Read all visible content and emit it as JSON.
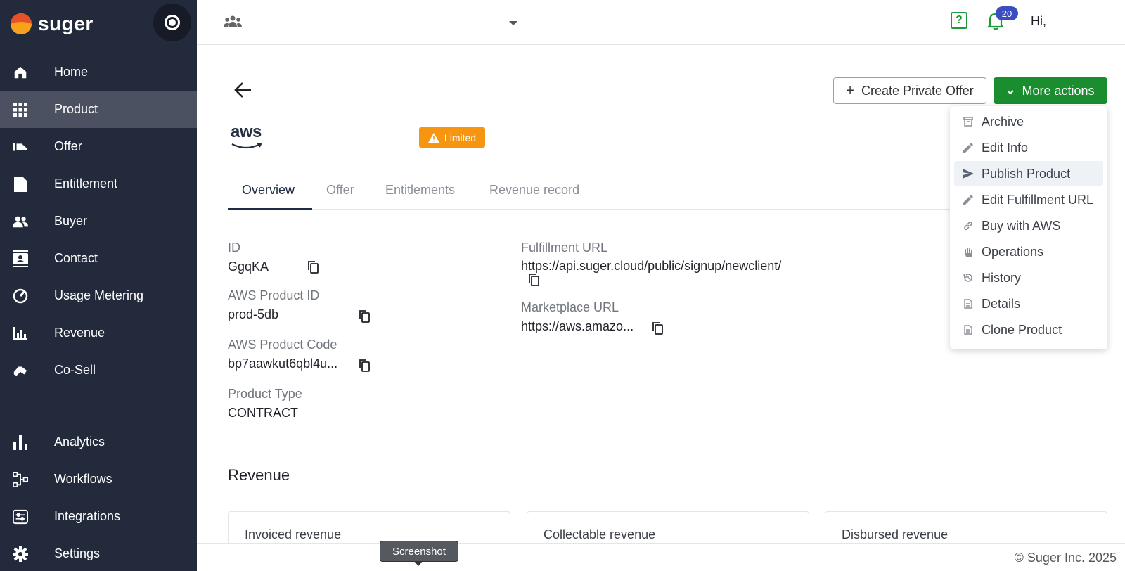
{
  "brand": {
    "name": "suger"
  },
  "sidebar": {
    "items": [
      {
        "label": "Home",
        "icon": "home-icon"
      },
      {
        "label": "Product",
        "icon": "grid-icon",
        "active": true
      },
      {
        "label": "Offer",
        "icon": "offer-icon"
      },
      {
        "label": "Entitlement",
        "icon": "document-icon"
      },
      {
        "label": "Buyer",
        "icon": "people-icon"
      },
      {
        "label": "Contact",
        "icon": "contact-card-icon"
      },
      {
        "label": "Usage Metering",
        "icon": "gauge-icon"
      },
      {
        "label": "Revenue",
        "icon": "revenue-chart-icon"
      },
      {
        "label": "Co-Sell",
        "icon": "handshake-icon"
      },
      {
        "label": "Analytics",
        "icon": "bar-chart-icon"
      },
      {
        "label": "Workflows",
        "icon": "workflow-icon"
      },
      {
        "label": "Integrations",
        "icon": "integrations-icon"
      },
      {
        "label": "Settings",
        "icon": "gear-icon"
      }
    ]
  },
  "header": {
    "notification_count": "20",
    "greeting": "Hi,"
  },
  "actions": {
    "create_private_offer": "Create Private Offer",
    "more_actions": "More actions"
  },
  "product": {
    "marketplace": "aws",
    "status": "Limited"
  },
  "tabs": [
    "Overview",
    "Offer",
    "Entitlements",
    "Revenue record"
  ],
  "fields": {
    "id_label": "ID",
    "id_value": "GgqKA",
    "aws_product_id_label": "AWS Product ID",
    "aws_product_id_value": "prod-5db",
    "aws_product_code_label": "AWS Product Code",
    "aws_product_code_value": "bp7aawkut6qbl4u...",
    "product_type_label": "Product Type",
    "product_type_value": "CONTRACT",
    "fulfillment_url_label": "Fulfillment URL",
    "fulfillment_url_value": "https://api.suger.cloud/public/signup/newclient/",
    "marketplace_url_label": "Marketplace URL",
    "marketplace_url_value": "https://aws.amazo..."
  },
  "revenue": {
    "title": "Revenue",
    "cards": [
      "Invoiced revenue",
      "Collectable revenue",
      "Disbursed revenue"
    ]
  },
  "menu": {
    "items": [
      {
        "label": "Archive",
        "icon": "archive-icon"
      },
      {
        "label": "Edit Info",
        "icon": "pencil-icon"
      },
      {
        "label": "Publish Product",
        "icon": "send-icon",
        "highlighted": true
      },
      {
        "label": "Edit Fulfillment URL",
        "icon": "pencil-icon"
      },
      {
        "label": "Buy with AWS",
        "icon": "link-icon"
      },
      {
        "label": "Operations",
        "icon": "hand-icon"
      },
      {
        "label": "History",
        "icon": "history-icon"
      },
      {
        "label": "Details",
        "icon": "file-icon"
      },
      {
        "label": "Clone Product",
        "icon": "file-icon"
      }
    ]
  },
  "tooltip": "Screenshot",
  "footer": {
    "copyright": "© Suger Inc. 2025"
  },
  "colors": {
    "sidebar_bg": "#222a3c",
    "sidebar_active": "#4b5160",
    "primary_green": "#1a8d2e",
    "warning_orange": "#f6950f",
    "badge_blue": "#3a4ec0",
    "brand_orange": "#f7a21b"
  }
}
